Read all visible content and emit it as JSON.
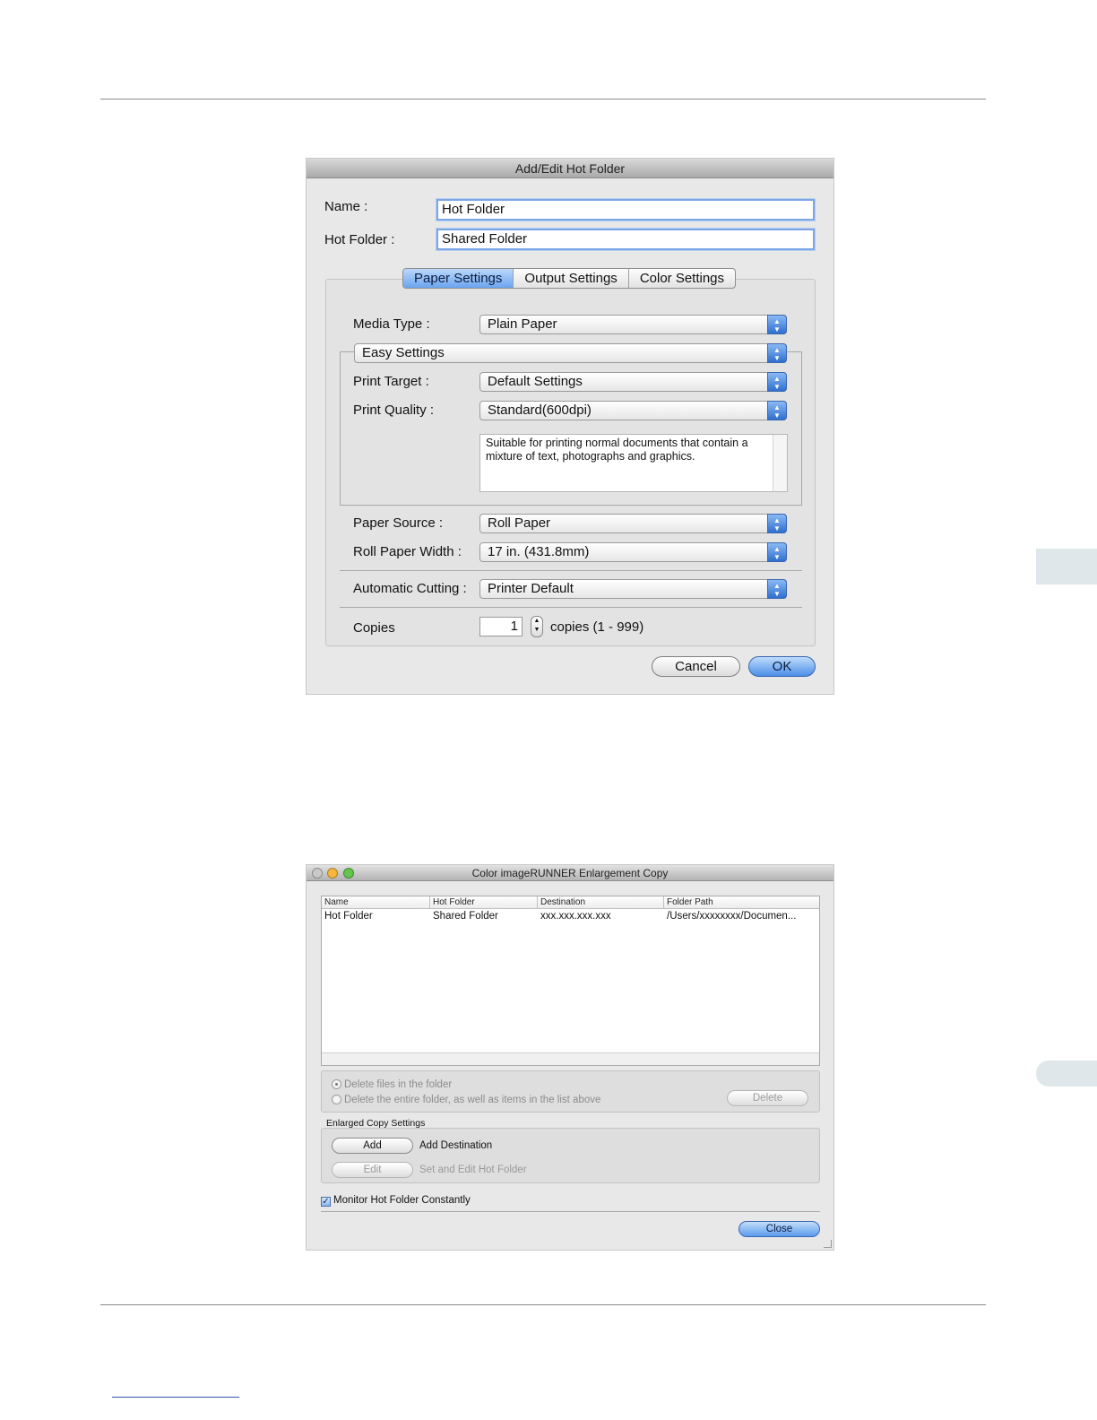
{
  "dialog1": {
    "title": "Add/Edit Hot Folder",
    "name_label": "Name :",
    "name_value": "Hot Folder",
    "hotfolder_label": "Hot Folder :",
    "hotfolder_value": "Shared Folder",
    "tabs": [
      "Paper Settings",
      "Output Settings",
      "Color Settings"
    ],
    "media_type_label": "Media Type :",
    "media_type_value": "Plain Paper",
    "mode_value": "Easy Settings",
    "print_target_label": "Print Target :",
    "print_target_value": "Default Settings",
    "print_quality_label": "Print Quality :",
    "print_quality_value": "Standard(600dpi)",
    "description": "Suitable for printing normal documents that contain a mixture of text, photographs and graphics.",
    "paper_source_label": "Paper Source :",
    "paper_source_value": "Roll Paper",
    "roll_width_label": "Roll Paper Width :",
    "roll_width_value": "17 in. (431.8mm)",
    "auto_cut_label": "Automatic Cutting :",
    "auto_cut_value": "Printer Default",
    "copies_label": "Copies",
    "copies_value": "1",
    "copies_range": "copies (1 - 999)",
    "cancel_label": "Cancel",
    "ok_label": "OK"
  },
  "dialog2": {
    "title": "Color imageRUNNER Enlargement Copy",
    "columns": [
      "Name",
      "Hot Folder",
      "Destination",
      "Folder Path"
    ],
    "rows": [
      [
        "Hot Folder",
        "Shared Folder",
        "xxx.xxx.xxx.xxx",
        "/Users/xxxxxxxx/Documen..."
      ]
    ],
    "radio_delete_files": "Delete files in the folder",
    "radio_delete_folder": "Delete the entire folder, as well as items in the list above",
    "delete_label": "Delete",
    "section_label": "Enlarged Copy Settings",
    "add_label": "Add",
    "add_desc": "Add Destination",
    "edit_label": "Edit",
    "edit_desc": "Set and Edit Hot Folder",
    "monitor_label": "Monitor Hot Folder Constantly",
    "close_label": "Close"
  },
  "colors": {
    "accent_blue": "#4c8fe8",
    "title_gray": "#a9a9a9",
    "traffic_red": "#f35c4f",
    "traffic_yellow": "#f5b63a",
    "traffic_green": "#63c54e"
  }
}
